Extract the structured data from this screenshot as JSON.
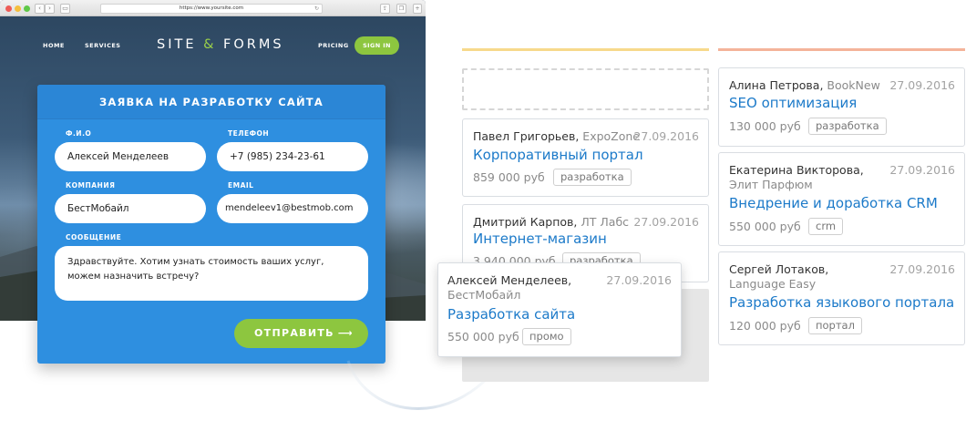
{
  "browser": {
    "url": "https://www.yoursite.com",
    "nav": {
      "home": "HOME",
      "services": "SERVICES",
      "logo_part1": "SITE",
      "logo_amp": "&",
      "logo_part2": "FORMS",
      "pricing": "PRICING",
      "signin": "SIGN IN"
    }
  },
  "form": {
    "title": "ЗАЯВКА НА РАЗРАБОТКУ САЙТА",
    "fio_label": "Ф.И.О",
    "fio_value": "Алексей Менделеев",
    "phone_label": "ТЕЛЕФОН",
    "phone_value": "+7 (985) 234-23-61",
    "company_label": "КОМПАНИЯ",
    "company_value": "БестМобайл",
    "email_label": "EMAIL",
    "email_value": "mendeleev1@bestmob.com",
    "message_label": "СООБЩЕНИЕ",
    "message_value": "Здравствуйте. Хотим узнать стоимость ваших услуг, можем назначить встречу?",
    "send_label": "ОТПРАВИТЬ",
    "send_arrow": "⟶"
  },
  "columns": {
    "left_color": "#f7d98b",
    "right_color": "#f4b49a"
  },
  "cards_left": [
    {
      "name": "Павел Григорьев,",
      "company": "ExpoZone",
      "date": "27.09.2016",
      "title": "Корпоративный портал",
      "price": "859 000 руб",
      "tag": "разработка"
    },
    {
      "name": "Дмитрий Карпов,",
      "company": "ЛТ Лабс",
      "date": "27.09.2016",
      "title": "Интернет-магазин",
      "price": "3 940 000 руб",
      "tag": "разработка"
    }
  ],
  "drag_card": {
    "name": "Алексей Менделеев,",
    "company": "БестМобайл",
    "date": "27.09.2016",
    "title": "Разработка сайта",
    "price": "550 000 руб",
    "tag": "промо"
  },
  "cards_right": [
    {
      "name": "Алина Петрова,",
      "company": "BookNew",
      "date": "27.09.2016",
      "title": "SEO оптимизация",
      "price": "130 000 руб",
      "tag": "разработка"
    },
    {
      "name": "Екатерина Викторова,",
      "company": "Элит Парфюм",
      "date": "27.09.2016",
      "title": "Внедрение и доработка CRM",
      "price": "550 000 руб",
      "tag": "crm"
    },
    {
      "name": "Сергей Лотаков,",
      "company": "Language Easy",
      "date": "27.09.2016",
      "title": "Разработка языкового портала",
      "price": "120 000 руб",
      "tag": "портал"
    }
  ]
}
